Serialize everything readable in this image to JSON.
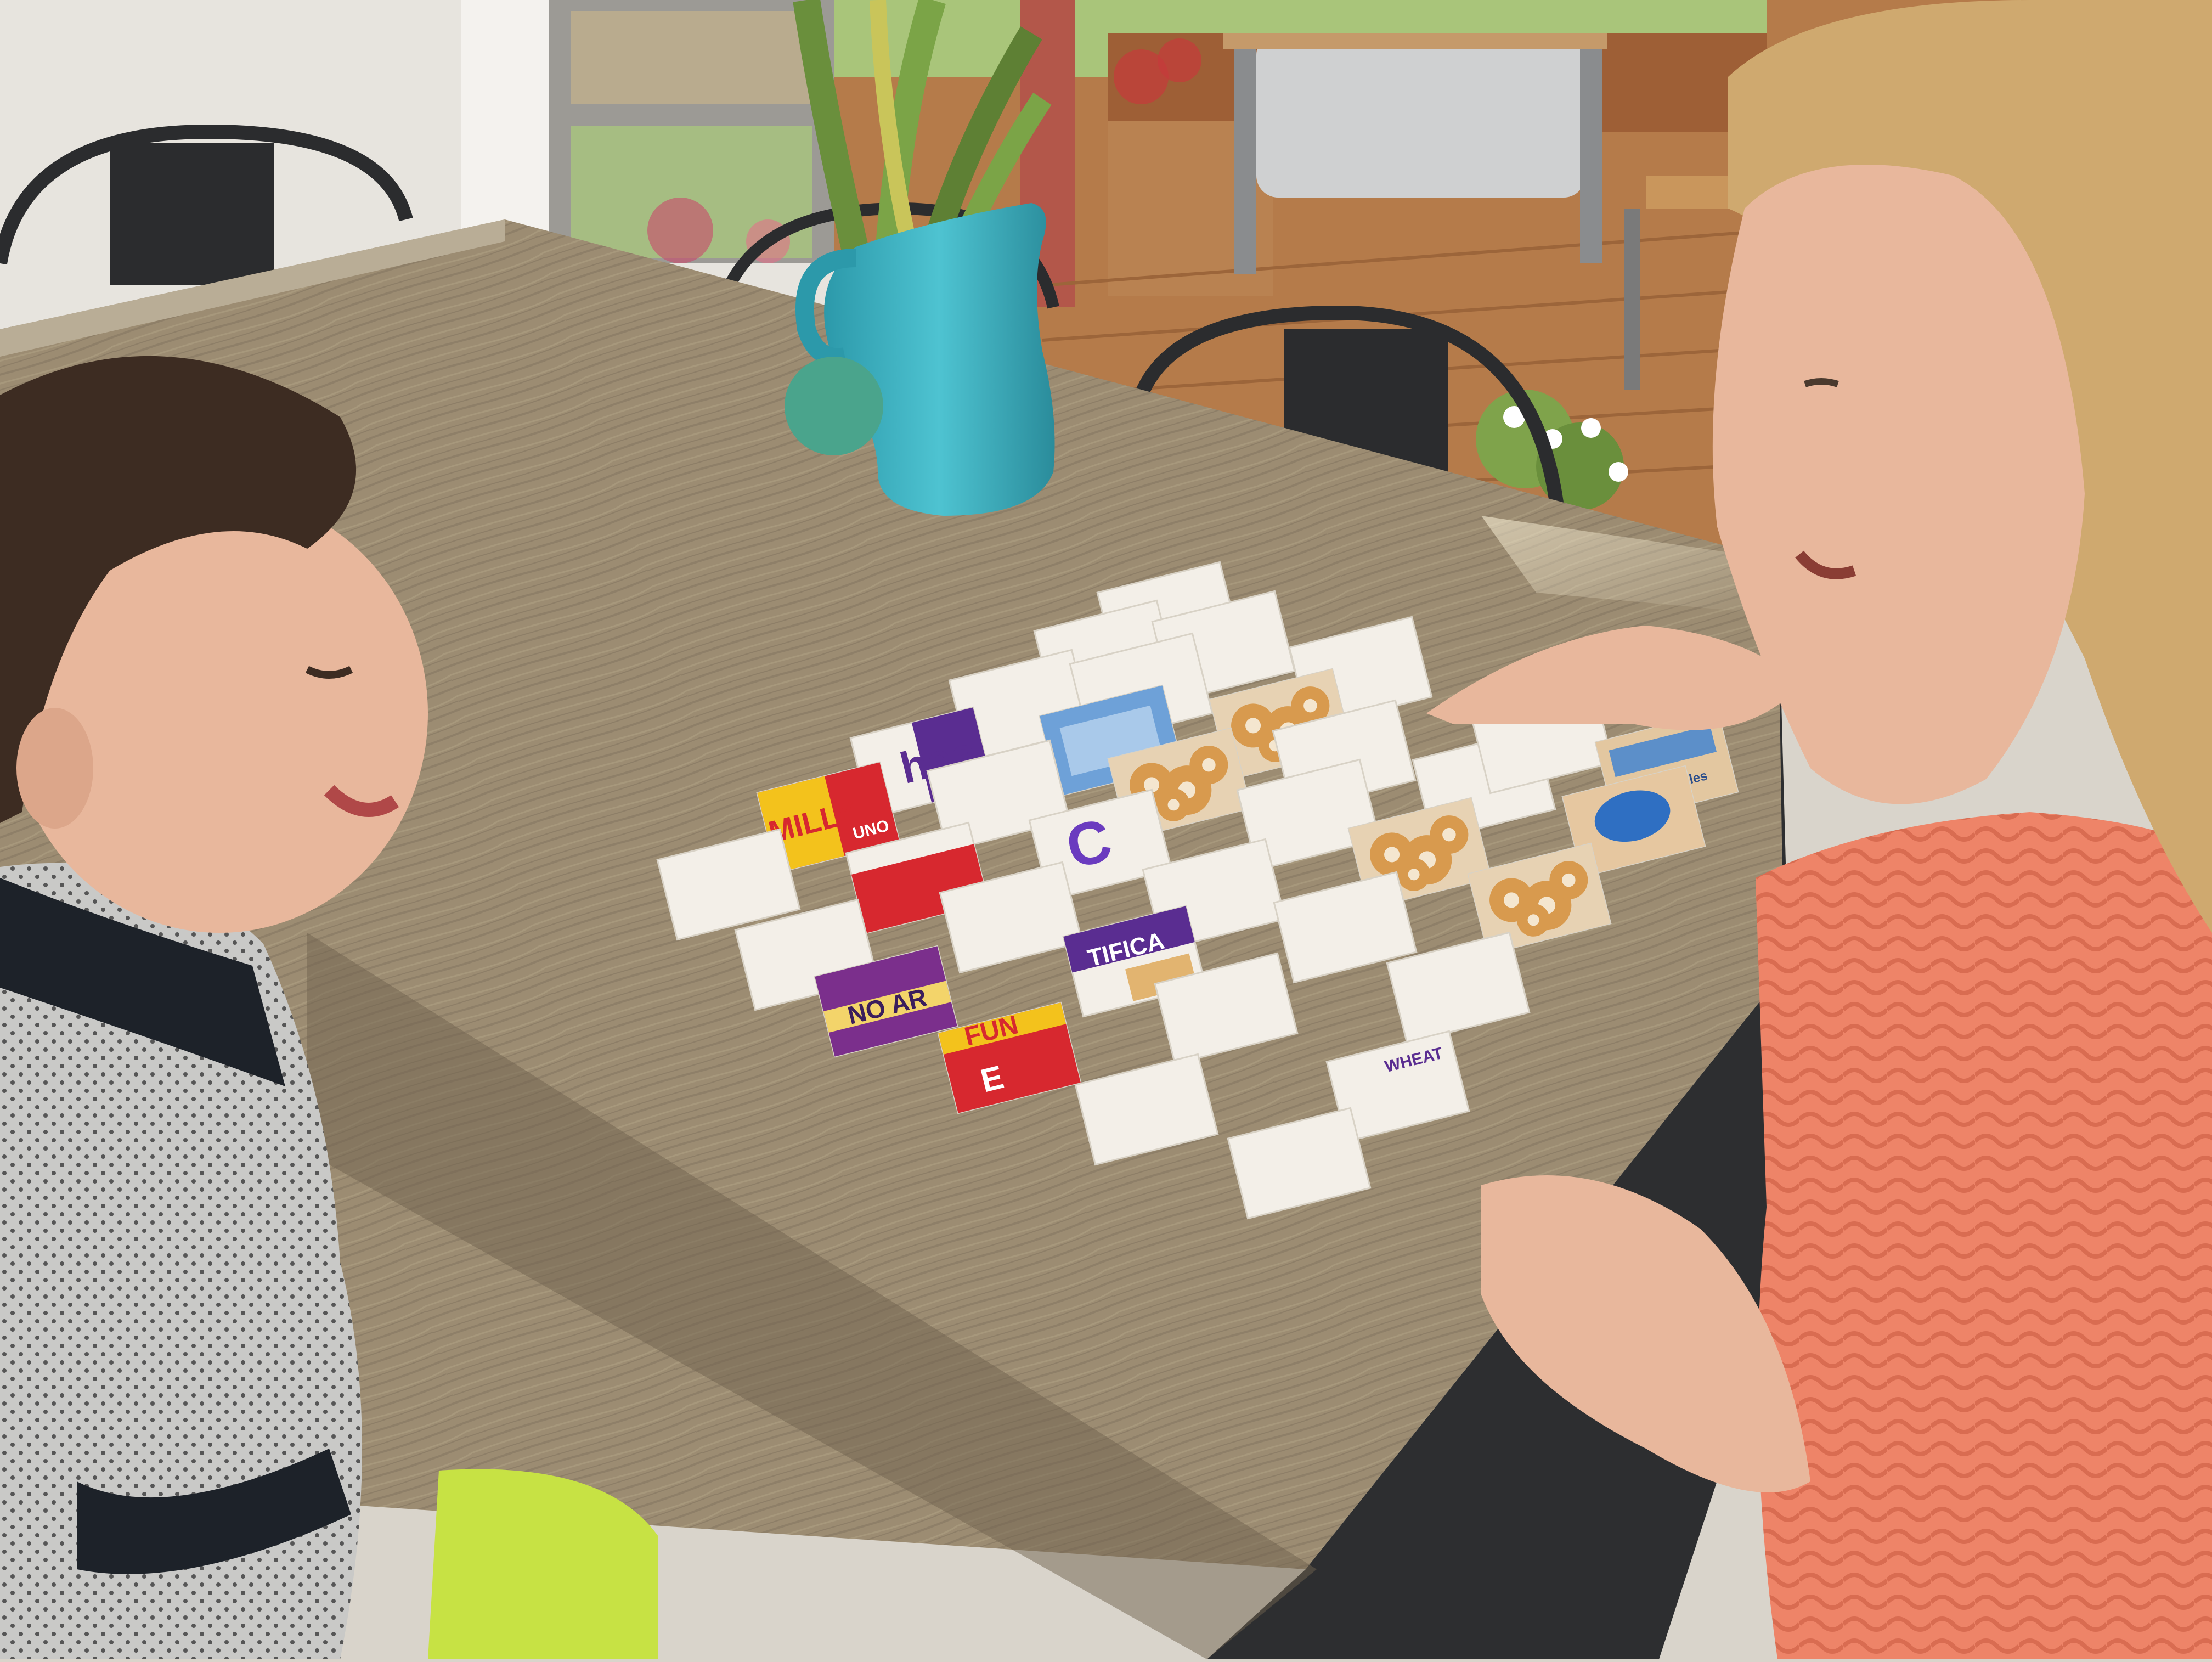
{
  "photo": {
    "colors": {
      "wall": "#e7e4de",
      "window_frame": "#9c9a95",
      "grass": "#a9c57a",
      "deck": "#b57b4a",
      "table": "#9c8c72",
      "table_dark": "#6f624e",
      "table_edge": "#2d2e30",
      "chair": "#2b2c2e",
      "pitcher": "#3eb6c5",
      "plant": "#6a8f3c",
      "card_face_down": "#f3efe8",
      "boy_hair": "#3d2c22",
      "boy_shirt": "#c8c8c8",
      "boy_shorts": "#c7e244",
      "woman_hair": "#cfa96f",
      "woman_sweater": "#ee8468",
      "skin": "#e8b79c"
    }
  },
  "cards": {
    "labels": [
      {
        "id": "milly",
        "text": "MILLY",
        "sub": "UNO"
      },
      {
        "id": "hee",
        "text": "hee"
      },
      {
        "id": "ck",
        "text": "C"
      },
      {
        "id": "tifica",
        "text": "TIFICA"
      },
      {
        "id": "noar",
        "text": "NO AR"
      },
      {
        "id": "fun",
        "text": "FUN",
        "sub": "E"
      },
      {
        "id": "wheat",
        "text": "WHEAT"
      },
      {
        "id": "rice",
        "text": "ice·Bubbles"
      }
    ]
  }
}
